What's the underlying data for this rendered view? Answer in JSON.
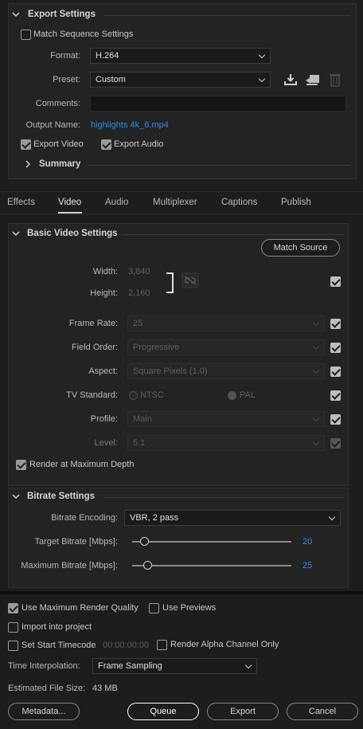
{
  "export_settings": {
    "title": "Export Settings",
    "match_sequence": "Match Sequence Settings",
    "format_label": "Format:",
    "format_value": "H.264",
    "preset_label": "Preset:",
    "preset_value": "Custom",
    "comments_label": "Comments:",
    "output_name_label": "Output Name:",
    "output_name_value": "highlights 4k_6.mp4",
    "export_video": "Export Video",
    "export_audio": "Export Audio",
    "summary": "Summary"
  },
  "tabs": [
    "Effects",
    "Video",
    "Audio",
    "Multiplexer",
    "Captions",
    "Publish"
  ],
  "basic_video": {
    "title": "Basic Video Settings",
    "match_source": "Match Source",
    "width_label": "Width:",
    "width_value": "3,840",
    "height_label": "Height:",
    "height_value": "2,160",
    "frame_rate_label": "Frame Rate:",
    "frame_rate_value": "25",
    "field_order_label": "Field Order:",
    "field_order_value": "Progressive",
    "aspect_label": "Aspect:",
    "aspect_value": "Square Pixels (1.0)",
    "tv_standard_label": "TV Standard:",
    "tv_ntsc": "NTSC",
    "tv_pal": "PAL",
    "profile_label": "Profile:",
    "profile_value": "Main",
    "level_label": "Level:",
    "level_value": "5.1",
    "render_max_depth": "Render at Maximum Depth"
  },
  "bitrate": {
    "title": "Bitrate Settings",
    "encoding_label": "Bitrate Encoding:",
    "encoding_value": "VBR, 2 pass",
    "target_label": "Target Bitrate [Mbps]:",
    "target_value": "20",
    "max_label": "Maximum Bitrate [Mbps]:",
    "max_value": "25"
  },
  "footer": {
    "use_max_render": "Use Maximum Render Quality",
    "use_previews": "Use Previews",
    "import_project": "Import into project",
    "set_start_timecode": "Set Start Timecode",
    "timecode_value": "00:00:00:00",
    "render_alpha": "Render Alpha Channel Only",
    "time_interp_label": "Time Interpolation:",
    "time_interp_value": "Frame Sampling",
    "file_size_label": "Estimated File Size:",
    "file_size_value": "43 MB",
    "metadata_button": "Metadata...",
    "queue_button": "Queue",
    "export_button": "Export",
    "cancel_button": "Cancel"
  },
  "colors": {
    "accent_link": "#2d8ceb",
    "background": "#1d1d1d",
    "panel": "#232323"
  }
}
